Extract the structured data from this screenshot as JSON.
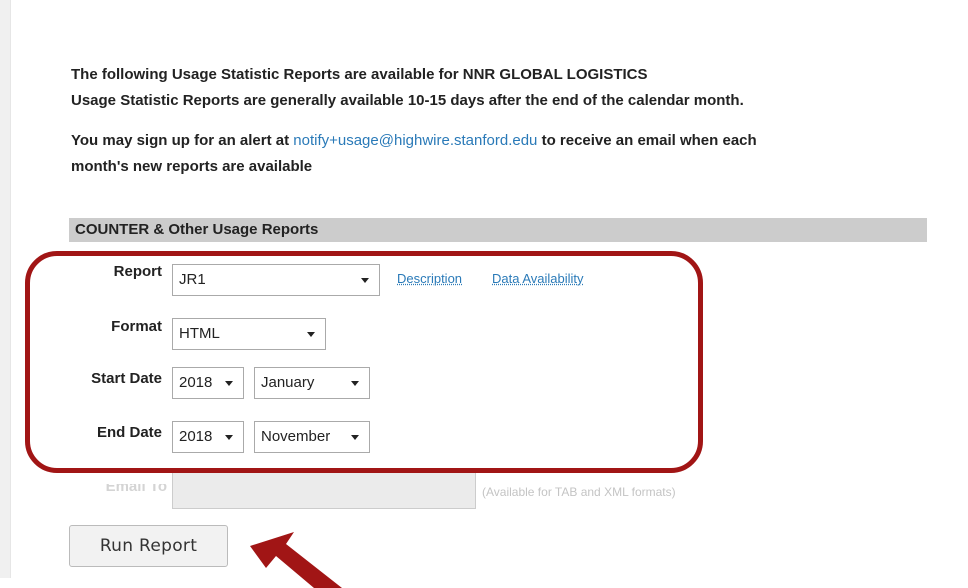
{
  "intro": {
    "line1": "The following Usage Statistic Reports are available for NNR GLOBAL LOGISTICS",
    "line2": "Usage Statistic Reports are generally available 10-15 days after the end of the calendar month.",
    "alert_prefix": "You may sign up for an alert at ",
    "alert_email": "notify+usage@highwire.stanford.edu",
    "alert_suffix": " to receive an email when each",
    "alert_line2": "month's new reports are available"
  },
  "section": {
    "title": "COUNTER & Other Usage Reports"
  },
  "form": {
    "report_label": "Report",
    "report_value": "JR1",
    "description_link": "Description",
    "availability_link": "Data Availability",
    "format_label": "Format",
    "format_value": "HTML",
    "start_label": "Start Date",
    "start_year": "2018",
    "start_month": "January",
    "end_label": "End Date",
    "end_year": "2018",
    "end_month": "November",
    "email_label": "Email To",
    "email_value": "",
    "email_hint": "(Available for TAB and XML formats)",
    "run_button": "Run Report"
  },
  "colors": {
    "link": "#2a7ab8",
    "section_bg": "#cccccc",
    "highlight": "#a11515"
  },
  "icons": {
    "dropdown": "chevron-down-icon",
    "annotation": "arrow-pointer-icon"
  }
}
